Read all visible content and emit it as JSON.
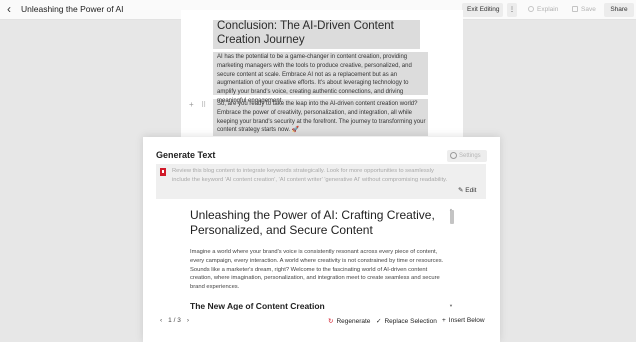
{
  "topbar": {
    "back": "‹",
    "title": "Unleashing the Power of AI",
    "exit_label": "Exit Editing",
    "more_label": "⋮",
    "explain_label": "Explain",
    "save_label": "Save",
    "share_label": "Share"
  },
  "document": {
    "heading": "Conclusion: The AI-Driven Content Creation Journey",
    "paragraph1": "AI has the potential to be a game-changer in content creation, providing marketing managers with the tools to produce creative, personalized, and secure content at scale. Embrace AI not as a replacement but as an augmentation of your creative efforts. It's about leveraging technology to amplify your brand's voice, creating authentic connections, and driving meaningful engagement.",
    "paragraph2": "So, are you ready to take the leap into the AI-driven content creation world? Embrace the power of creativity, personalization, and integration, all while keeping your brand's security at the forefront. The journey to transforming your content strategy starts now.",
    "rocket": "🚀"
  },
  "panel": {
    "title": "Generate Text",
    "settings_label": "Settings",
    "suggestion": "Review this blog content to integrate keywords strategically. Look for more opportunities to seamlessly include the keyword 'AI content creation', 'AI content writer' 'generative AI' without compromising readability.",
    "edit_label": "Edit",
    "preview": {
      "title": "Unleashing the Power of AI: Crafting Creative, Personalized, and Secure Content",
      "body": "Imagine a world where your brand's voice is consistently resonant across every piece of content, every campaign, every interaction. A world where creativity is not constrained by time or resources. Sounds like a marketer's dream, right? Welcome to the fascinating world of AI-driven content creation, where imagination, personalization, and integration meet to create seamless and secure brand experiences.",
      "subheading": "The New Age of Content Creation"
    },
    "pager": {
      "prev": "‹",
      "label": "1 / 3",
      "next": "›"
    },
    "regenerate_label": "Regenerate",
    "replace_label": "Replace Selection",
    "insert_label": "Insert Below"
  }
}
